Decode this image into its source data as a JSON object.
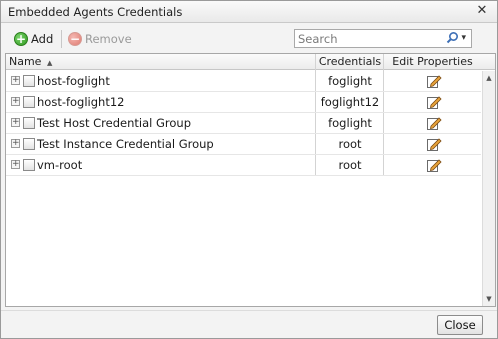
{
  "window": {
    "title": "Embedded Agents Credentials",
    "close_glyph": "✕"
  },
  "toolbar": {
    "add_label": "Add",
    "add_icon": "+",
    "remove_label": "Remove",
    "remove_icon": "−",
    "search_placeholder": "Search",
    "search_dropdown_glyph": "▾"
  },
  "grid": {
    "columns": {
      "name": "Name",
      "name_sort_glyph": "▲",
      "credentials": "Credentials",
      "edit": "Edit Properties"
    },
    "rows": [
      {
        "name": "host-foglight",
        "credentials": "foglight"
      },
      {
        "name": "host-foglight12",
        "credentials": "foglight12"
      },
      {
        "name": "Test Host Credential Group",
        "credentials": "foglight"
      },
      {
        "name": "Test Instance Credential Group",
        "credentials": "root"
      },
      {
        "name": "vm-root",
        "credentials": "root"
      }
    ],
    "expander_glyph": "+",
    "scroll_up_glyph": "▲",
    "scroll_down_glyph": "▼"
  },
  "footer": {
    "close_label": "Close"
  },
  "icons": {
    "add": "add-circle-icon",
    "remove": "remove-circle-icon",
    "search": "search-icon",
    "edit": "edit-pencil-icon"
  },
  "colors": {
    "add_green": "#2f9a1f",
    "remove_red": "#e07a70",
    "pencil_orange": "#e8a33a"
  }
}
